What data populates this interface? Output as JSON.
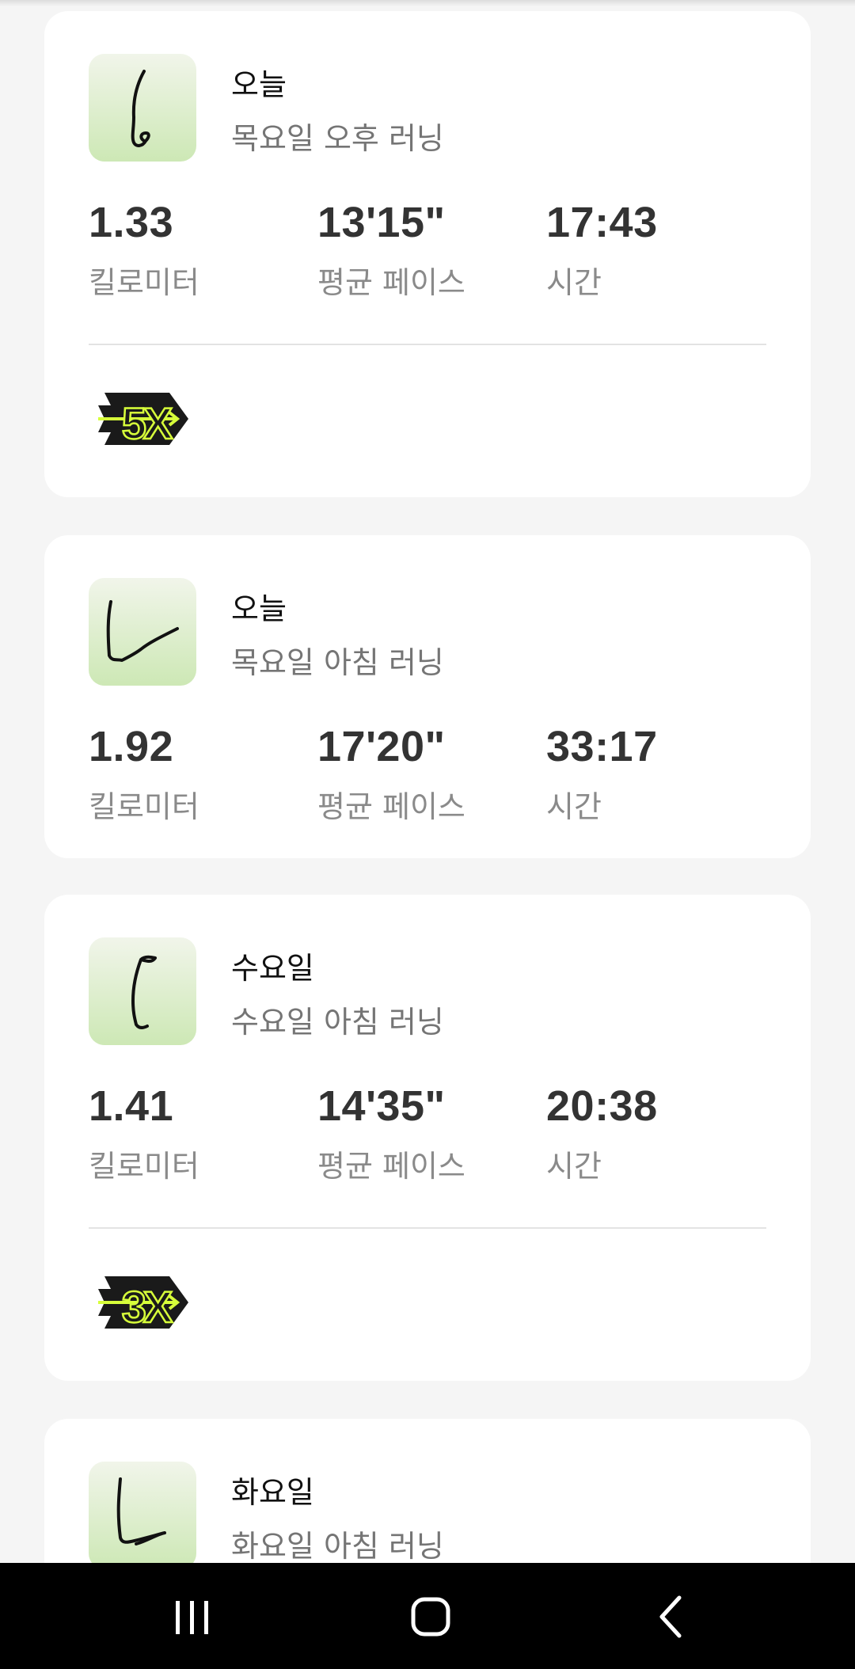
{
  "activities": [
    {
      "day": "오늘",
      "title": "목요일 오후 러닝",
      "distance": "1.33",
      "distance_label": "킬로미터",
      "pace": "13'15\"",
      "pace_label": "평균 페이스",
      "time": "17:43",
      "time_label": "시간",
      "badge": "5X"
    },
    {
      "day": "오늘",
      "title": "목요일 아침 러닝",
      "distance": "1.92",
      "distance_label": "킬로미터",
      "pace": "17'20\"",
      "pace_label": "평균 페이스",
      "time": "33:17",
      "time_label": "시간"
    },
    {
      "day": "수요일",
      "title": "수요일 아침 러닝",
      "distance": "1.41",
      "distance_label": "킬로미터",
      "pace": "14'35\"",
      "pace_label": "평균 페이스",
      "time": "20:38",
      "time_label": "시간",
      "badge": "3X"
    },
    {
      "day": "화요일",
      "title": "화요일 아침 러닝"
    }
  ],
  "colors": {
    "background": "#f5f5f5",
    "card": "#ffffff",
    "badge_fill": "#1a1a1a",
    "badge_accent": "#d7ff3a",
    "map_gradient_top": "#f1f5ea",
    "map_gradient_bottom": "#cde8b5"
  },
  "icons": {
    "route_map": "route-map-icon",
    "badge": "streak-badge-icon",
    "nav_recents": "recents-icon",
    "nav_home": "home-icon",
    "nav_back": "back-icon"
  }
}
